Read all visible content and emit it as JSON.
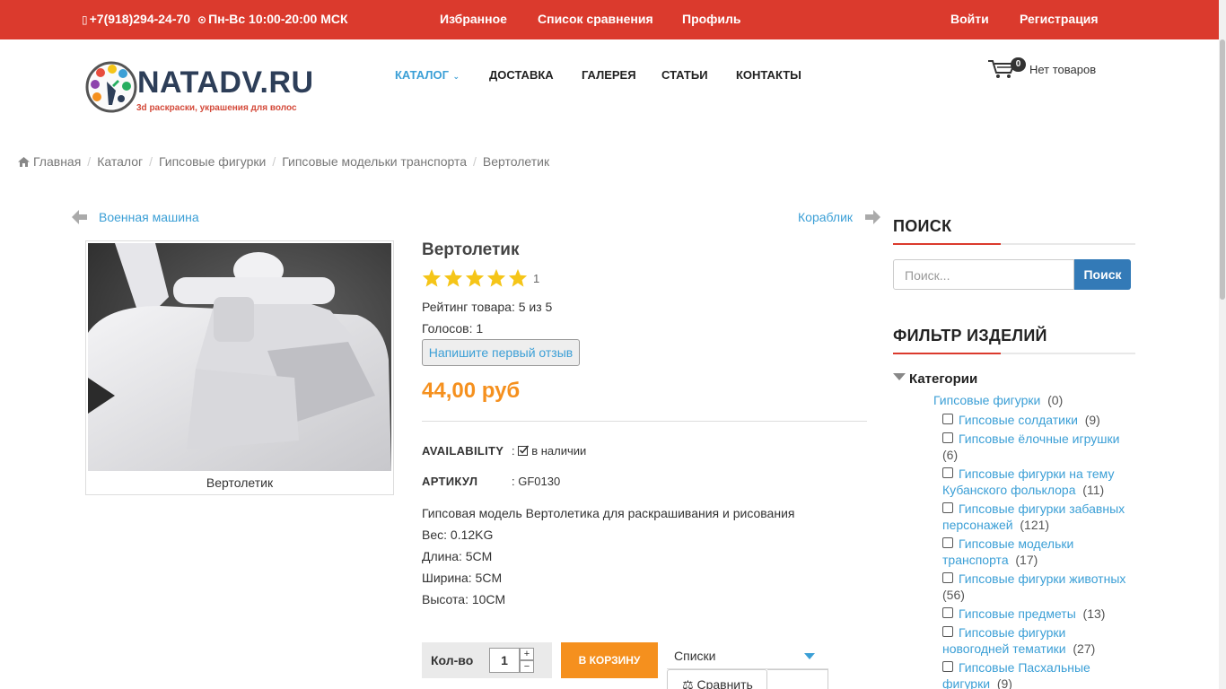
{
  "topbar": {
    "phone": "+7(918)294-24-70",
    "hours": "Пн-Вс 10:00-20:00 МСК",
    "favorites": "Избранное",
    "compare_list": "Список сравнения",
    "profile": "Профиль",
    "login": "Войти",
    "register": "Регистрация"
  },
  "brand": {
    "name": "NATADV.RU",
    "tagline": "3d раскраски, украшения для волос"
  },
  "nav": {
    "catalog": "Каталог",
    "delivery": "Доставка",
    "gallery": "Галерея",
    "articles": "Статьи",
    "contacts": "Контакты"
  },
  "cart": {
    "count": "0",
    "label": "Нет товаров"
  },
  "breadcrumb": [
    "Главная",
    "Каталог",
    "Гипсовые фигурки",
    "Гипсовые модельки транспорта",
    "Вертолетик"
  ],
  "prev_product": "Военная машина",
  "next_product": "Кораблик",
  "product": {
    "image_caption": "Вертолетик",
    "title": "Вертолетик",
    "rating": 5,
    "rating_votes_badge": "1",
    "rating_text": "Рейтинг товара: 5 из 5",
    "votes_text": "Голосов: 1",
    "review_button": "Напишите первый отзыв",
    "price": "44,00 руб",
    "availability_label": "AVAILABILITY",
    "availability_value": "в наличии",
    "sku_label": "АРТИКУЛ",
    "sku_value": "GF0130",
    "description": "Гипсовая модель Вертолетика для раскрашивания и рисования",
    "weight": "Вес: 0.12KG",
    "length": "Длина: 5CM",
    "width": "Ширина: 5CM",
    "height": "Высота: 10CM",
    "qty_label": "Кол-во",
    "qty_value": "1",
    "add_to_cart": "В КОРЗИНУ",
    "lists_select": "Списки",
    "compare_button": "Сравнить"
  },
  "sidebar": {
    "search_title": "Поиск",
    "search_placeholder": "Поиск...",
    "search_button": "Поиск",
    "filter_title": "Фильтр изделий",
    "categories_label": "Категории",
    "root_category": {
      "name": "Гипсовые фигурки",
      "count": "(0)"
    },
    "categories": [
      {
        "name": "Гипсовые солдатики",
        "count": "(9)"
      },
      {
        "name": "Гипсовые ёлочные игрушки",
        "count": "(6)"
      },
      {
        "name": "Гипсовые фигурки на тему Кубанского фольклора",
        "count": "(11)"
      },
      {
        "name": "Гипсовые фигурки забавных персонажей",
        "count": "(121)"
      },
      {
        "name": "Гипсовые модельки транспорта",
        "count": "(17)"
      },
      {
        "name": "Гипсовые фигурки животных",
        "count": "(56)"
      },
      {
        "name": "Гипсовые предметы",
        "count": "(13)"
      },
      {
        "name": "Гипсовые фигурки новогодней тематики",
        "count": "(27)"
      },
      {
        "name": "Гипсовые Пасхальные фигурки",
        "count": "(9)"
      }
    ]
  },
  "colors": {
    "topbar": "#db3a2d",
    "accent_link": "#3b9fd6",
    "price": "#f5901e",
    "search_button": "#337ab7",
    "star": "#f5c518"
  }
}
